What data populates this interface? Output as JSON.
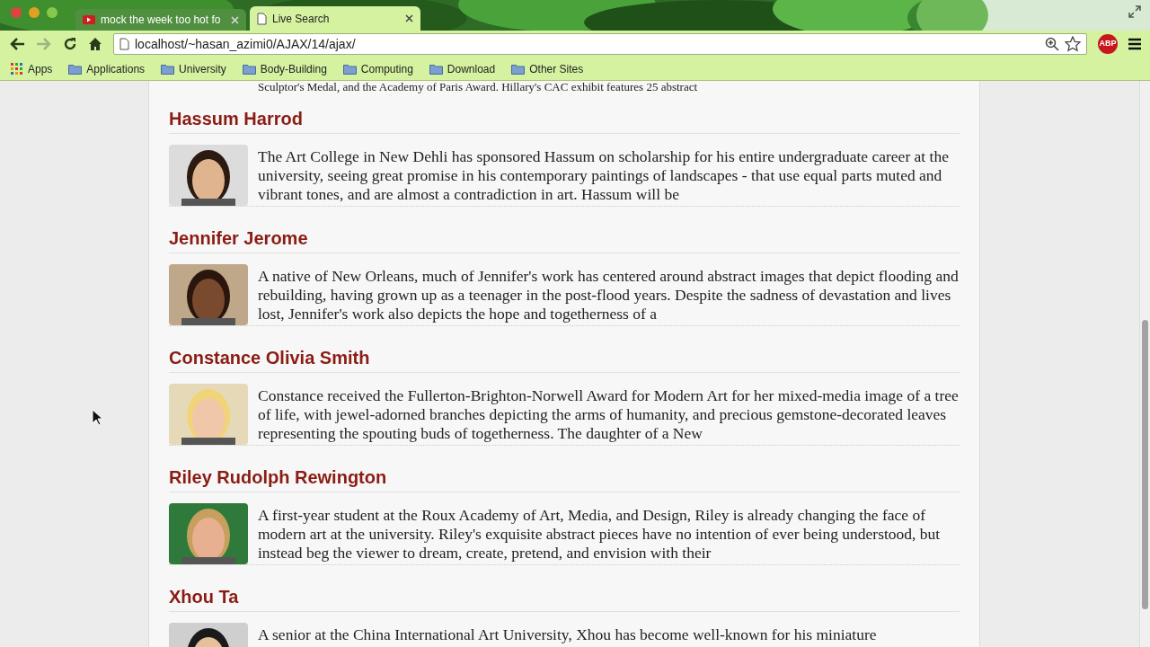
{
  "tabs": [
    {
      "title": "mock the week too hot fo",
      "kind": "video",
      "selected": false
    },
    {
      "title": "Live Search",
      "kind": "page",
      "selected": true
    }
  ],
  "address": "localhost/~hasan_azimi0/AJAX/14/ajax/",
  "bookmarks": [
    {
      "label": "Apps",
      "kind": "apps"
    },
    {
      "label": "Applications",
      "kind": "folder"
    },
    {
      "label": "University",
      "kind": "folder"
    },
    {
      "label": "Body-Building",
      "kind": "folder"
    },
    {
      "label": "Computing",
      "kind": "folder"
    },
    {
      "label": "Download",
      "kind": "folder"
    },
    {
      "label": "Other Sites",
      "kind": "folder"
    }
  ],
  "extension_badge": "ABP",
  "partial_line": "Sculptor's Medal, and the Academy of Paris Award. Hillary's CAC exhibit features 25 abstract",
  "artists": [
    {
      "name": "Hassum Harrod",
      "bio": "The Art College in New Dehli has sponsored Hassum on scholarship for his entire undergraduate career at the university, seeing great promise in his contemporary paintings of landscapes - that use equal parts muted and vibrant tones, and are almost a contradiction in art. Hassum will be"
    },
    {
      "name": "Jennifer Jerome",
      "bio": "A native of New Orleans, much of Jennifer's work has centered around abstract images that depict flooding and rebuilding, having grown up as a teenager in the post-flood years. Despite the sadness of devastation and lives lost, Jennifer's work also depicts the hope and togetherness of a"
    },
    {
      "name": "Constance Olivia Smith",
      "bio": "Constance received the Fullerton-Brighton-Norwell Award for Modern Art for her mixed-media image of a tree of life, with jewel-adorned branches depicting the arms of humanity, and precious gemstone-decorated leaves representing the spouting buds of togetherness. The daughter of a New"
    },
    {
      "name": "Riley Rudolph Rewington",
      "bio": "A first-year student at the Roux Academy of Art, Media, and Design, Riley is already changing the face of modern art at the university. Riley's exquisite abstract pieces have no intention of ever being understood, but instead beg the viewer to dream, create, pretend, and envision with their"
    },
    {
      "name": "Xhou Ta",
      "bio": "A senior at the China International Art University, Xhou has become well-known for his miniature"
    }
  ]
}
